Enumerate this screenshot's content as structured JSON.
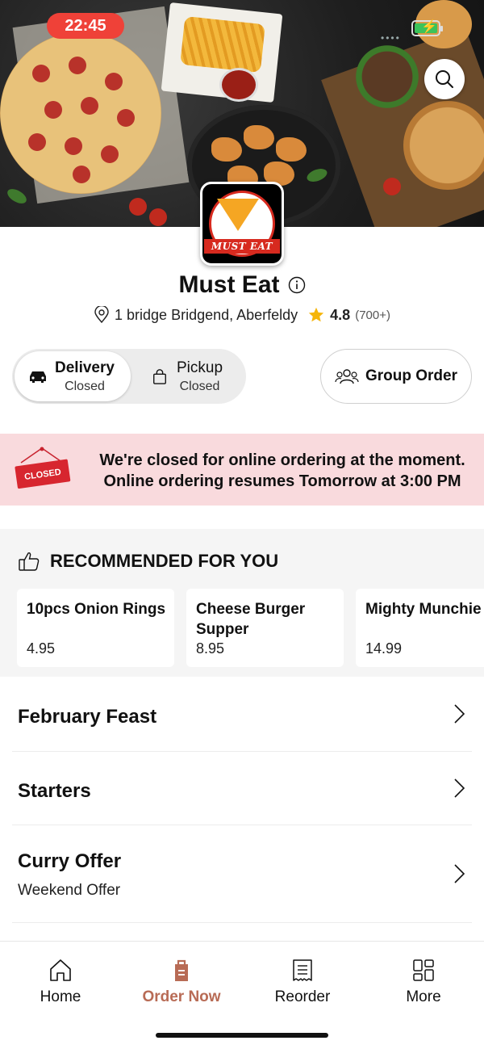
{
  "status_bar": {
    "time": "22:45"
  },
  "store": {
    "name": "Must Eat",
    "logo_text": "MUST EAT",
    "address": "1 bridge Bridgend, Aberfeldy",
    "rating": "4.8",
    "rating_count": "(700+)"
  },
  "order_mode": {
    "delivery": {
      "label": "Delivery",
      "status": "Closed",
      "selected": true
    },
    "pickup": {
      "label": "Pickup",
      "status": "Closed",
      "selected": false
    },
    "group_order_label": "Group Order"
  },
  "closed_banner": {
    "sign_text": "CLOSED",
    "line1": "We're closed for online ordering at the moment.",
    "line2": "Online ordering resumes Tomorrow at 3:00 PM"
  },
  "recommended": {
    "heading": "RECOMMENDED FOR YOU",
    "items": [
      {
        "name": "10pcs Onion Rings",
        "price": "4.95"
      },
      {
        "name": "Cheese Burger Supper",
        "price": "8.95"
      },
      {
        "name": "Mighty Munchie Box",
        "price": "14.99"
      }
    ]
  },
  "categories": [
    {
      "title": "February Feast",
      "subtitle": ""
    },
    {
      "title": "Starters",
      "subtitle": ""
    },
    {
      "title": "Curry Offer",
      "subtitle": "Weekend Offer"
    }
  ],
  "bottom_nav": [
    {
      "label": "Home",
      "icon": "home-icon",
      "active": false
    },
    {
      "label": "Order Now",
      "icon": "order-bag-icon",
      "active": true
    },
    {
      "label": "Reorder",
      "icon": "receipt-icon",
      "active": false
    },
    {
      "label": "More",
      "icon": "grid-icon",
      "active": false
    }
  ],
  "colors": {
    "accent": "#b86b55",
    "closed_banner_bg": "#f9dadd",
    "status_time_bg": "#ef4138",
    "star": "#f5b50a"
  }
}
